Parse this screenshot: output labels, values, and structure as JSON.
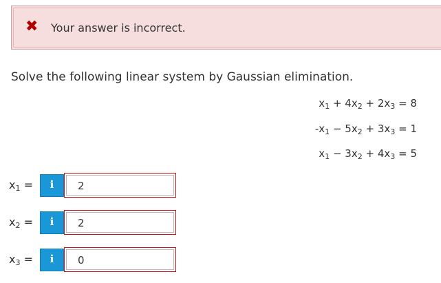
{
  "feedback": {
    "icon": "x-mark-icon",
    "icon_glyph": "✖",
    "message": "Your answer is incorrect."
  },
  "question": {
    "prompt": "Solve the following linear system by Gaussian elimination."
  },
  "equations": [
    {
      "t1_coef": "",
      "t1_var": "x",
      "t1_sub": "1",
      "op1": "+",
      "t2_coef": "4",
      "t2_var": "x",
      "t2_sub": "2",
      "op2": "+",
      "t3_coef": "2",
      "t3_var": "x",
      "t3_sub": "3",
      "rhs": "8"
    },
    {
      "t1_coef": "-",
      "t1_var": "x",
      "t1_sub": "1",
      "op1": "−",
      "t2_coef": "5",
      "t2_var": "x",
      "t2_sub": "2",
      "op2": "+",
      "t3_coef": "3",
      "t3_var": "x",
      "t3_sub": "3",
      "rhs": "1"
    },
    {
      "t1_coef": "",
      "t1_var": "x",
      "t1_sub": "1",
      "op1": "−",
      "t2_coef": "3",
      "t2_var": "x",
      "t2_sub": "2",
      "op2": "+",
      "t3_coef": "4",
      "t3_var": "x",
      "t3_sub": "3",
      "rhs": "5"
    }
  ],
  "answers": [
    {
      "var": "x",
      "sub": "1",
      "equals": "=",
      "info_glyph": "i",
      "value": "2"
    },
    {
      "var": "x",
      "sub": "2",
      "equals": "=",
      "info_glyph": "i",
      "value": "2"
    },
    {
      "var": "x",
      "sub": "3",
      "equals": "=",
      "info_glyph": "i",
      "value": "0"
    }
  ],
  "colors": {
    "error_red": "#b20000",
    "feedback_bg": "#f5dddd",
    "info_blue": "#1a97d6",
    "input_border_red": "#c91616"
  }
}
